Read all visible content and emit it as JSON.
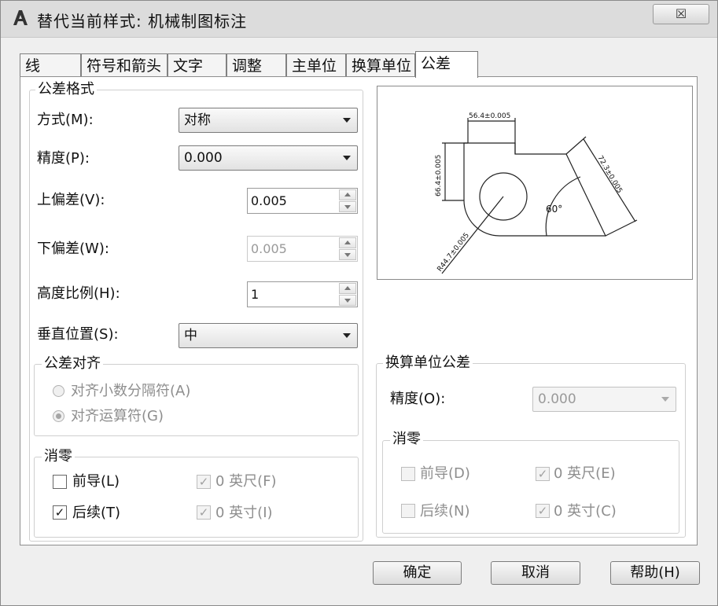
{
  "window": {
    "title": "替代当前样式: 机械制图标注",
    "close_glyph": "☒"
  },
  "tabs": [
    "线",
    "符号和箭头",
    "文字",
    "调整",
    "主单位",
    "换算单位",
    "公差"
  ],
  "tolerance_format": {
    "group_title": "公差格式",
    "method_label": "方式(M):",
    "method_value": "对称",
    "precision_label": "精度(P):",
    "precision_value": "0.000",
    "upper_label": "上偏差(V):",
    "upper_value": "0.005",
    "lower_label": "下偏差(W):",
    "lower_value": "0.005",
    "height_label": "高度比例(H):",
    "height_value": "1",
    "vertical_label": "垂直位置(S):",
    "vertical_value": "中"
  },
  "alignment": {
    "group_title": "公差对齐",
    "option1": "对齐小数分隔符(A)",
    "option2": "对齐运算符(G)",
    "selected": "option2"
  },
  "zero_suppression": {
    "group_title": "消零",
    "leading": "前导(L)",
    "leading_checked": false,
    "trailing": "后续(T)",
    "trailing_checked": true,
    "feet": "0 英尺(F)",
    "feet_checked": true,
    "inches": "0 英寸(I)",
    "inches_checked": true
  },
  "preview": {
    "dim_top": "56.4±0.005",
    "dim_left": "66.4±0.005",
    "dim_right": "72.3±0.005",
    "dim_radius": "R44.7±0.005",
    "angle": "60°"
  },
  "alt_units": {
    "group_title": "换算单位公差",
    "precision_label": "精度(O):",
    "precision_value": "0.000",
    "zero_title": "消零",
    "leading": "前导(D)",
    "leading_checked": false,
    "trailing": "后续(N)",
    "trailing_checked": false,
    "feet": "0 英尺(E)",
    "feet_checked": true,
    "inches": "0 英寸(C)",
    "inches_checked": true
  },
  "buttons": {
    "ok": "确定",
    "cancel": "取消",
    "help": "帮助(H)"
  },
  "check_mark": "✓"
}
